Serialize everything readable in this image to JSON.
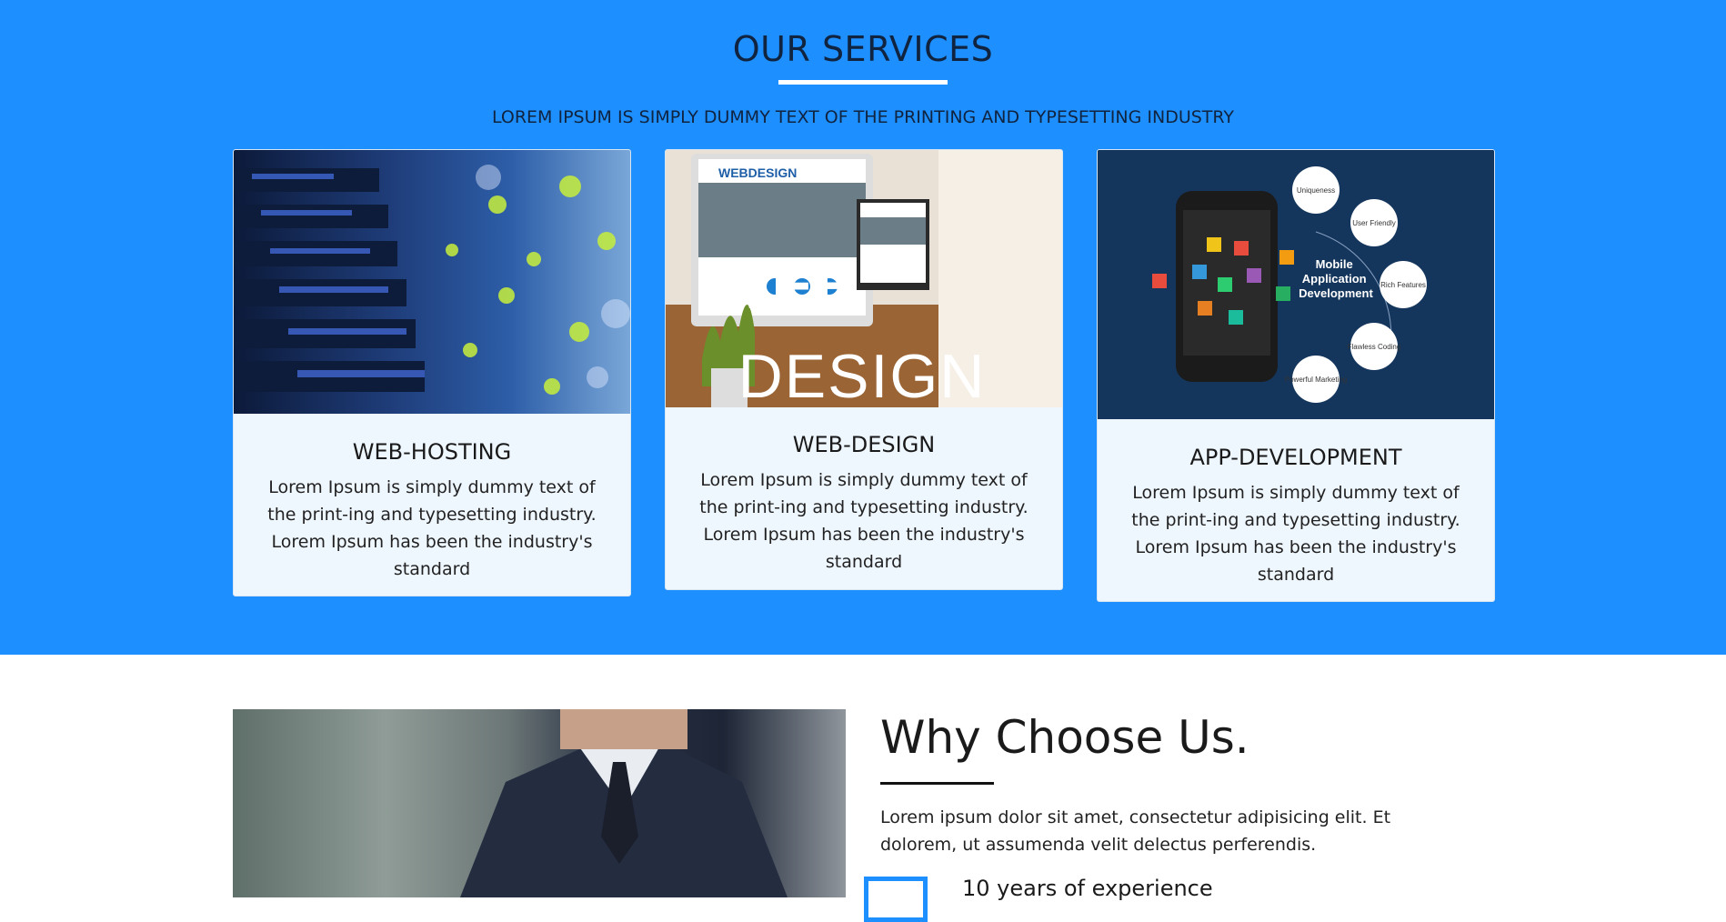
{
  "services": {
    "title": "OUR SERVICES",
    "subtitle": "LOREM IPSUM IS SIMPLY DUMMY TEXT OF THE PRINTING AND TYPESETTING INDUSTRY",
    "cards": [
      {
        "title": "WEB-HOSTING",
        "text": "Lorem Ipsum is simply dummy text of the print-ing and typesetting industry. Lorem Ipsum has been the industry's standard",
        "image": "server-rack-image"
      },
      {
        "title": "WEB-DESIGN",
        "text": "Lorem Ipsum is simply dummy text of the print-ing and typesetting industry. Lorem Ipsum has been the industry's standard",
        "image": "web-design-desk-image",
        "image_text": [
          "WEBDESIGN",
          "WEB",
          "DESIGN"
        ]
      },
      {
        "title": "APP-DEVELOPMENT",
        "text": "Lorem Ipsum is simply dummy text of the print-ing and typesetting industry. Lorem Ipsum has been the industry's standard",
        "image": "mobile-app-development-image",
        "image_text": [
          "Mobile Application Development",
          "Uniqueness",
          "User Friendly",
          "Rich Features",
          "Flawless Coding",
          "Powerful Marketing"
        ]
      }
    ]
  },
  "why": {
    "title": "Why Choose Us.",
    "text": "Lorem ipsum dolor sit amet, consectetur adipisicing elit. Et dolorem, ut assumenda velit delectus perferendis.",
    "features": [
      {
        "label": "10 years of experience",
        "icon": "experience-icon"
      }
    ]
  },
  "colors": {
    "services_bg": "#1e8fff",
    "card_bg": "#eef6fe",
    "accent": "#1e8fff"
  }
}
